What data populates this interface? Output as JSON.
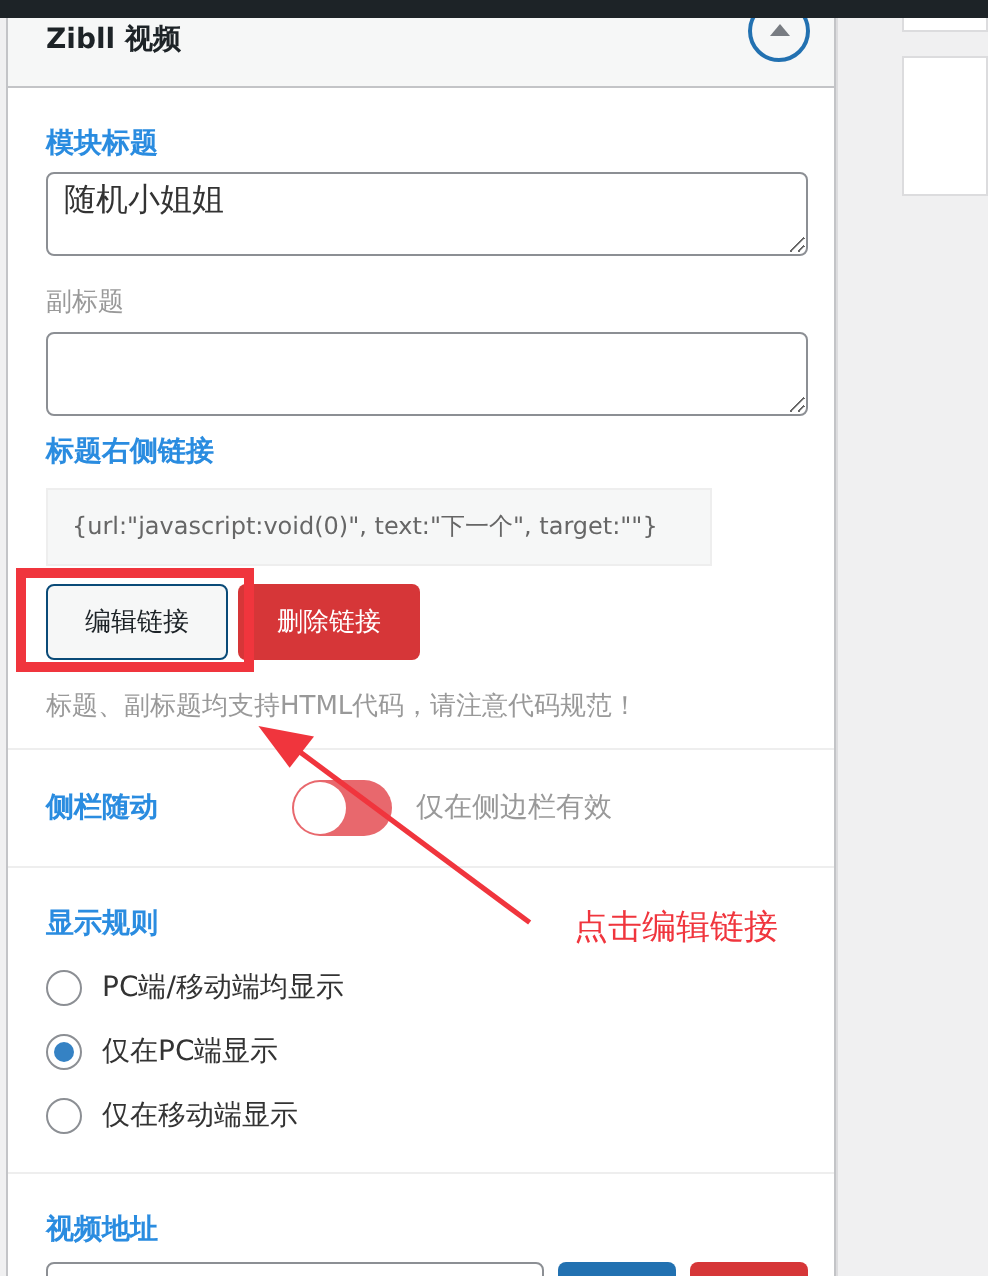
{
  "panel": {
    "title": "Zibll 视频",
    "expanded": true
  },
  "fields": [
    {
      "kind": "textarea",
      "label": "模块标题",
      "emphasized": true,
      "value": "随机小姐姐"
    },
    {
      "kind": "textarea",
      "label": "副标题",
      "emphasized": false
    }
  ],
  "link": {
    "label": "标题右侧链接",
    "value": "{url:\"javascript:void(0)\", text:\"下一个\", target:\"\"}",
    "buttons": [
      {
        "label": "编辑链接",
        "kind": "default"
      },
      {
        "label": "删除链接",
        "kind": "danger"
      }
    ],
    "help": "标题、副标题均支持HTML代码，请注意代码规范！"
  },
  "sidebar_follow": {
    "label": "侧栏随动",
    "on": false,
    "hint": "仅在侧边栏有效"
  },
  "display_rule": {
    "label": "显示规则",
    "options": [
      {
        "label": "PC端/移动端均显示",
        "selected": false
      },
      {
        "label": "仅在PC端显示",
        "selected": true
      },
      {
        "label": "仅在移动端显示",
        "selected": false
      }
    ]
  },
  "video": {
    "label": "视频地址",
    "buttons": [
      {
        "kind": "primary"
      },
      {
        "kind": "danger"
      }
    ]
  },
  "annotation": {
    "text": "点击编辑链接"
  }
}
